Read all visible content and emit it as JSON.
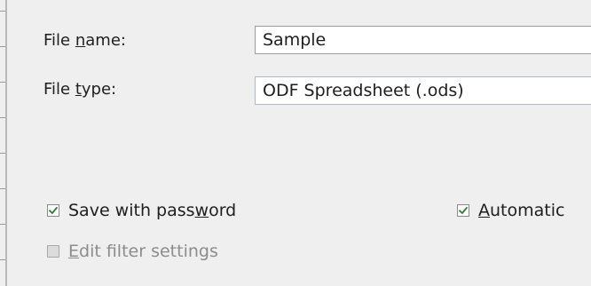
{
  "form": {
    "file_name_label": {
      "before": "File ",
      "accel": "n",
      "after": "ame:"
    },
    "file_name_value": "Sample",
    "file_type_label": {
      "before": "File ",
      "accel": "t",
      "after": "ype:"
    },
    "file_type_value": "ODF Spreadsheet (.ods)"
  },
  "options": {
    "save_with_password": {
      "before": "Save with pass",
      "accel": "w",
      "after": "ord",
      "checked": true
    },
    "automatic": {
      "before": "",
      "accel": "A",
      "after": "utomatic",
      "checked": true
    },
    "edit_filter_settings": {
      "before": "",
      "accel": "E",
      "after": "dit filter settings",
      "checked": false,
      "enabled": false
    }
  },
  "colors": {
    "check_mark": "#2e7d32",
    "disabled_text": "#8c8c8c"
  },
  "icons": {
    "checkbox_checked": "check-mark-icon"
  }
}
